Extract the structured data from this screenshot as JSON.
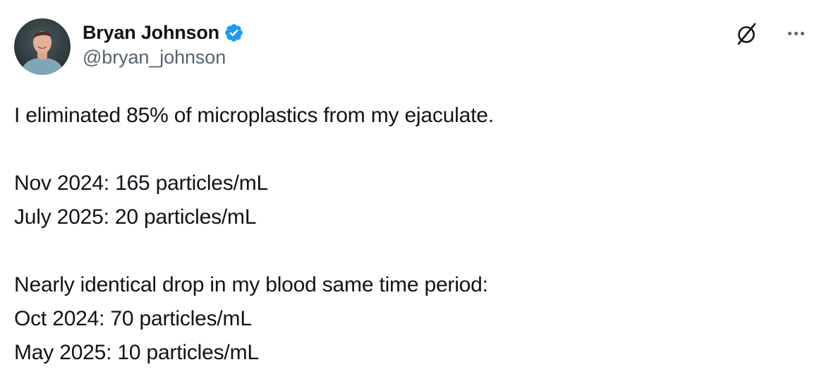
{
  "tweet": {
    "author": {
      "display_name": "Bryan Johnson",
      "handle": "@bryan_johnson",
      "verified": true,
      "verified_color": "#1d9bf0"
    },
    "icons": {
      "grok": "grok-icon",
      "more": "more-icon"
    },
    "text": {
      "line1": "I eliminated 85% of microplastics from my ejaculate.",
      "line2": "Nov 2024: 165 particles/mL",
      "line3": "July 2025: 20 particles/mL",
      "line4": "Nearly identical drop in my blood same time period:",
      "line5": "Oct 2024: 70 particles/mL",
      "line6": "May 2025: 10 particles/mL"
    }
  }
}
